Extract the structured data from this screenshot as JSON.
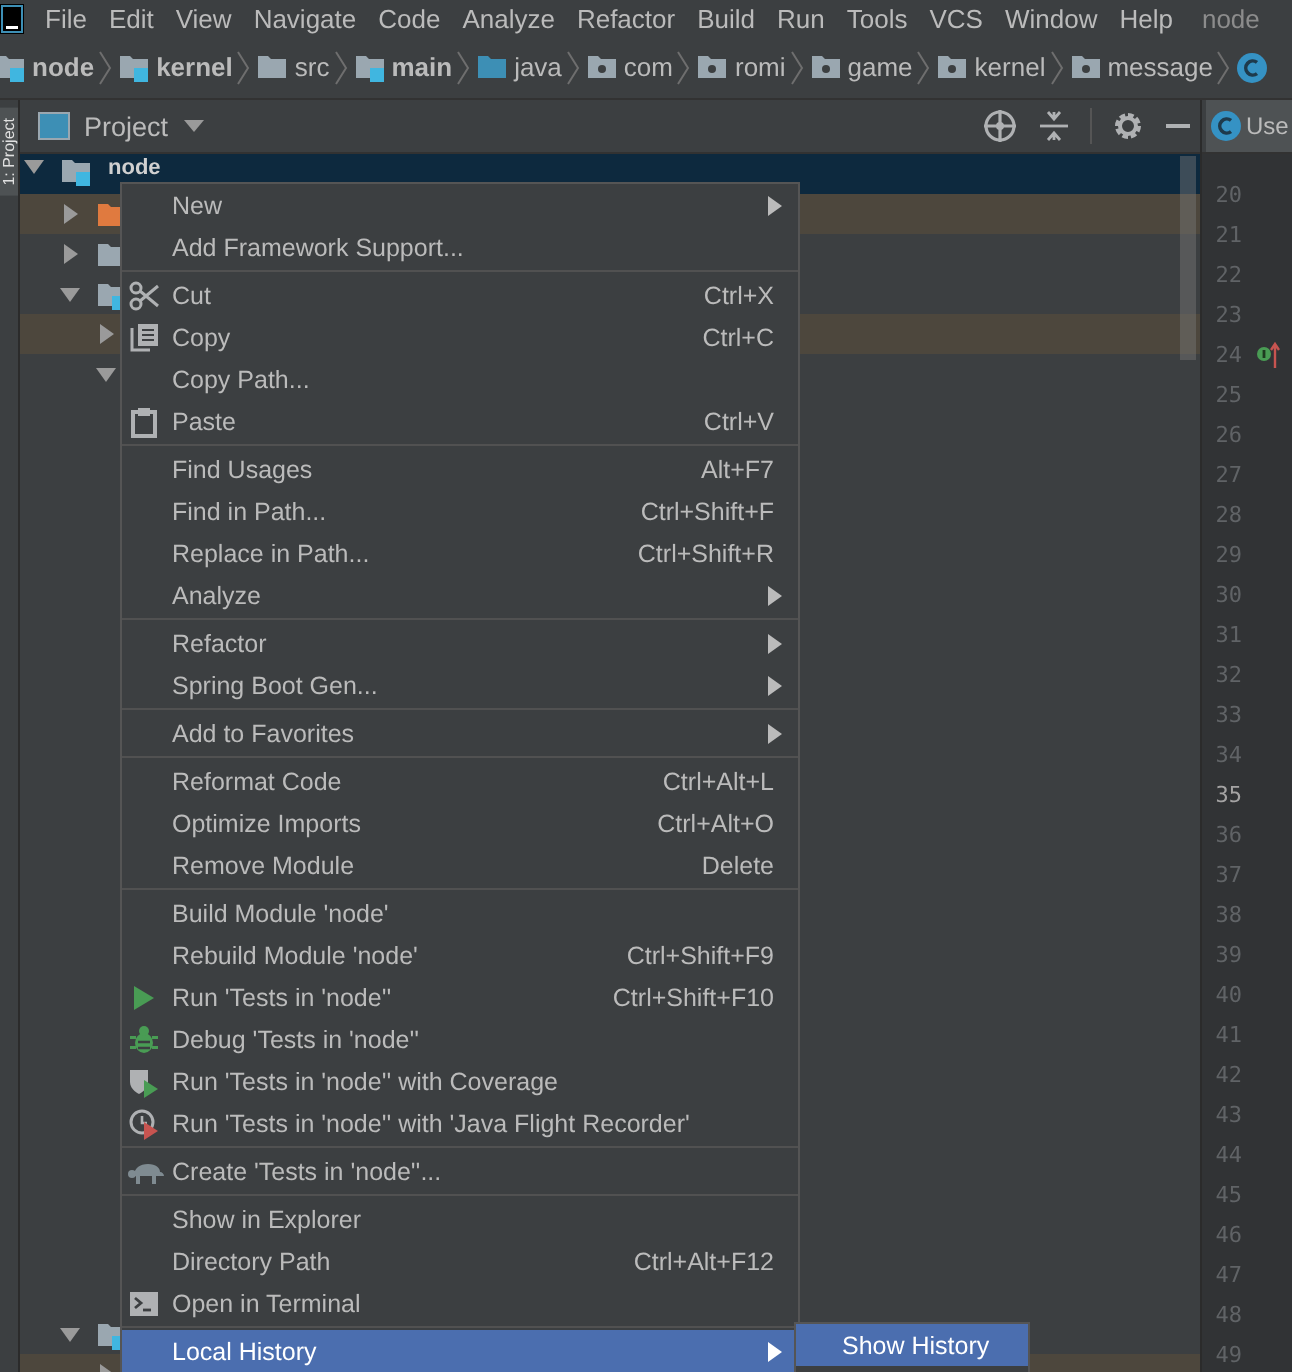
{
  "menubar": {
    "items": [
      "File",
      "Edit",
      "View",
      "Navigate",
      "Code",
      "Analyze",
      "Refactor",
      "Build",
      "Run",
      "Tools",
      "VCS",
      "Window",
      "Help"
    ],
    "project_name": "node"
  },
  "breadcrumbs": [
    {
      "label": "node",
      "kind": "module"
    },
    {
      "label": "kernel",
      "kind": "module"
    },
    {
      "label": "src",
      "kind": "folder"
    },
    {
      "label": "main",
      "kind": "module"
    },
    {
      "label": "java",
      "kind": "source"
    },
    {
      "label": "com",
      "kind": "package"
    },
    {
      "label": "romi",
      "kind": "package"
    },
    {
      "label": "game",
      "kind": "package"
    },
    {
      "label": "kernel",
      "kind": "package"
    },
    {
      "label": "message",
      "kind": "package"
    },
    {
      "kind": "class"
    }
  ],
  "tool_window": {
    "stripe_label": "1: Project",
    "title": "Project"
  },
  "tree": {
    "name": "node",
    "kind": "module",
    "expanded": true,
    "selected": true,
    "children": [
      {
        "kind": "excluded-folder",
        "expanded": false,
        "selected": false,
        "highlighted": true
      },
      {
        "kind": "folder",
        "expanded": false,
        "selected": false,
        "highlighted": false
      },
      {
        "kind": "module",
        "expanded": true,
        "selected": false,
        "highlighted": false,
        "children": [
          {
            "expanded": false,
            "selected": false,
            "highlighted": true
          },
          {
            "expanded": true,
            "selected": false,
            "highlighted": false
          }
        ]
      },
      {
        "kind": "module",
        "expanded": true,
        "selected": false,
        "highlighted": false,
        "children": [
          {
            "expanded": false,
            "selected": false,
            "highlighted": true
          }
        ]
      }
    ]
  },
  "editor": {
    "tab": "Use",
    "gutter": [
      {
        "number": "20",
        "kind": "plain",
        "current": false
      },
      {
        "number": "21",
        "kind": "plain",
        "current": false
      },
      {
        "number": "22",
        "kind": "plain",
        "current": false
      },
      {
        "number": "23",
        "kind": "plain",
        "current": false
      },
      {
        "number": "24",
        "kind": "marker",
        "current": false
      },
      {
        "number": "25",
        "kind": "plain",
        "current": false
      },
      {
        "number": "26",
        "kind": "plain",
        "current": false
      },
      {
        "number": "27",
        "kind": "plain",
        "current": false
      },
      {
        "number": "28",
        "kind": "plain",
        "current": false
      },
      {
        "number": "29",
        "kind": "plain",
        "current": false
      },
      {
        "number": "30",
        "kind": "plain",
        "current": false
      },
      {
        "number": "31",
        "kind": "plain",
        "current": false
      },
      {
        "number": "32",
        "kind": "plain",
        "current": false
      },
      {
        "number": "33",
        "kind": "plain",
        "current": false
      },
      {
        "number": "34",
        "kind": "plain",
        "current": false
      },
      {
        "number": "35",
        "kind": "plain",
        "current": true
      },
      {
        "number": "36",
        "kind": "plain",
        "current": false
      },
      {
        "number": "37",
        "kind": "plain",
        "current": false
      },
      {
        "number": "38",
        "kind": "plain",
        "current": false
      },
      {
        "number": "39",
        "kind": "plain",
        "current": false
      },
      {
        "number": "40",
        "kind": "plain",
        "current": false
      },
      {
        "number": "41",
        "kind": "plain",
        "current": false
      },
      {
        "number": "42",
        "kind": "plain",
        "current": false
      },
      {
        "number": "43",
        "kind": "plain",
        "current": false
      },
      {
        "number": "44",
        "kind": "plain",
        "current": false
      },
      {
        "number": "45",
        "kind": "plain",
        "current": false
      },
      {
        "number": "46",
        "kind": "plain",
        "current": false
      },
      {
        "number": "47",
        "kind": "plain",
        "current": false
      },
      {
        "number": "48",
        "kind": "plain",
        "current": false
      },
      {
        "number": "49",
        "kind": "plain",
        "current": false
      }
    ]
  },
  "context_menu": {
    "items": [
      {
        "kind": "plain",
        "label": "New",
        "submenu": true,
        "selected": false
      },
      {
        "kind": "plain",
        "label": "Add Framework Support...",
        "submenu": false,
        "selected": false
      },
      {
        "kind": "separator"
      },
      {
        "kind": "cut",
        "label": "Cut",
        "shortcut": "Ctrl+X",
        "submenu": false,
        "selected": false
      },
      {
        "kind": "copy",
        "label": "Copy",
        "shortcut": "Ctrl+C",
        "submenu": false,
        "selected": false
      },
      {
        "kind": "plain",
        "label": "Copy Path...",
        "submenu": false,
        "selected": false
      },
      {
        "kind": "paste",
        "label": "Paste",
        "shortcut": "Ctrl+V",
        "submenu": false,
        "selected": false
      },
      {
        "kind": "separator"
      },
      {
        "kind": "plain",
        "label": "Find Usages",
        "shortcut": "Alt+F7",
        "submenu": false,
        "selected": false
      },
      {
        "kind": "plain",
        "label": "Find in Path...",
        "shortcut": "Ctrl+Shift+F",
        "submenu": false,
        "selected": false
      },
      {
        "kind": "plain",
        "label": "Replace in Path...",
        "shortcut": "Ctrl+Shift+R",
        "submenu": false,
        "selected": false
      },
      {
        "kind": "plain",
        "label": "Analyze",
        "submenu": true,
        "selected": false
      },
      {
        "kind": "separator"
      },
      {
        "kind": "plain",
        "label": "Refactor",
        "submenu": true,
        "selected": false
      },
      {
        "kind": "plain",
        "label": "Spring Boot Gen...",
        "submenu": true,
        "selected": false
      },
      {
        "kind": "separator"
      },
      {
        "kind": "plain",
        "label": "Add to Favorites",
        "submenu": true,
        "selected": false
      },
      {
        "kind": "separator"
      },
      {
        "kind": "plain",
        "label": "Reformat Code",
        "shortcut": "Ctrl+Alt+L",
        "submenu": false,
        "selected": false
      },
      {
        "kind": "plain",
        "label": "Optimize Imports",
        "shortcut": "Ctrl+Alt+O",
        "submenu": false,
        "selected": false
      },
      {
        "kind": "plain",
        "label": "Remove Module",
        "shortcut": "Delete",
        "submenu": false,
        "selected": false
      },
      {
        "kind": "separator"
      },
      {
        "kind": "plain",
        "label": "Build Module 'node'",
        "submenu": false,
        "selected": false
      },
      {
        "kind": "plain",
        "label": "Rebuild Module 'node'",
        "shortcut": "Ctrl+Shift+F9",
        "submenu": false,
        "selected": false
      },
      {
        "kind": "run",
        "label": "Run 'Tests in 'node''",
        "shortcut": "Ctrl+Shift+F10",
        "submenu": false,
        "selected": false
      },
      {
        "kind": "debug",
        "label": "Debug 'Tests in 'node''",
        "submenu": false,
        "selected": false
      },
      {
        "kind": "coverage",
        "label": "Run 'Tests in 'node'' with Coverage",
        "submenu": false,
        "selected": false
      },
      {
        "kind": "profiler",
        "label": "Run 'Tests in 'node'' with 'Java Flight Recorder'",
        "submenu": false,
        "selected": false
      },
      {
        "kind": "separator"
      },
      {
        "kind": "create-test",
        "label": "Create 'Tests in 'node''...",
        "submenu": false,
        "selected": false
      },
      {
        "kind": "separator"
      },
      {
        "kind": "plain",
        "label": "Show in Explorer",
        "submenu": false,
        "selected": false
      },
      {
        "kind": "plain",
        "label": "Directory Path",
        "shortcut": "Ctrl+Alt+F12",
        "submenu": false,
        "selected": false
      },
      {
        "kind": "terminal",
        "label": "Open in Terminal",
        "submenu": false,
        "selected": false
      },
      {
        "kind": "separator"
      },
      {
        "kind": "plain",
        "label": "Local History",
        "submenu": true,
        "selected": true
      }
    ]
  },
  "submenu": {
    "items": [
      {
        "label": "Show History",
        "selected": true
      }
    ]
  }
}
